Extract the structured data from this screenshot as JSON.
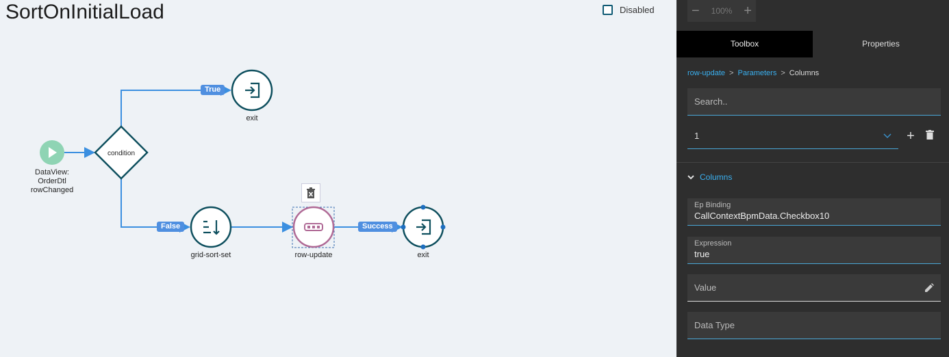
{
  "canvas": {
    "title": "SortOnInitialLoad",
    "disabled_label": "Disabled",
    "nodes": {
      "start": "DataView:\nOrderDtl\nrowChanged",
      "condition": "condition",
      "exit_top": "exit",
      "grid_sort_set": "grid-sort-set",
      "row_update": "row-update",
      "exit_bottom": "exit"
    },
    "edges": {
      "true_label": "True",
      "false_label": "False",
      "success_label": "Success"
    },
    "colors": {
      "node_stroke": "#0e4f5e",
      "edge": "#3b8fe0",
      "start_fill": "#8fd4b4",
      "selected_stroke": "#b06a96",
      "badge": "#4f8fe0"
    }
  },
  "panel": {
    "zoom": {
      "minus": "−",
      "value": "100%",
      "plus": "+"
    },
    "tabs": [
      {
        "label": "Toolbox",
        "active": true
      },
      {
        "label": "Properties",
        "active": false
      }
    ],
    "breadcrumb": {
      "item1": "row-update",
      "sep": ">",
      "item2": "Parameters",
      "item3": "Columns"
    },
    "search_placeholder": "Search..",
    "selected_value": "1",
    "add_label": "+",
    "section_title": "Columns",
    "fields": {
      "ep_binding": {
        "label": "Ep Binding",
        "value": "CallContextBpmData.Checkbox10"
      },
      "expression": {
        "label": "Expression",
        "value": "true"
      },
      "value": {
        "label": "Value"
      },
      "data_type": {
        "label": "Data Type"
      }
    }
  }
}
